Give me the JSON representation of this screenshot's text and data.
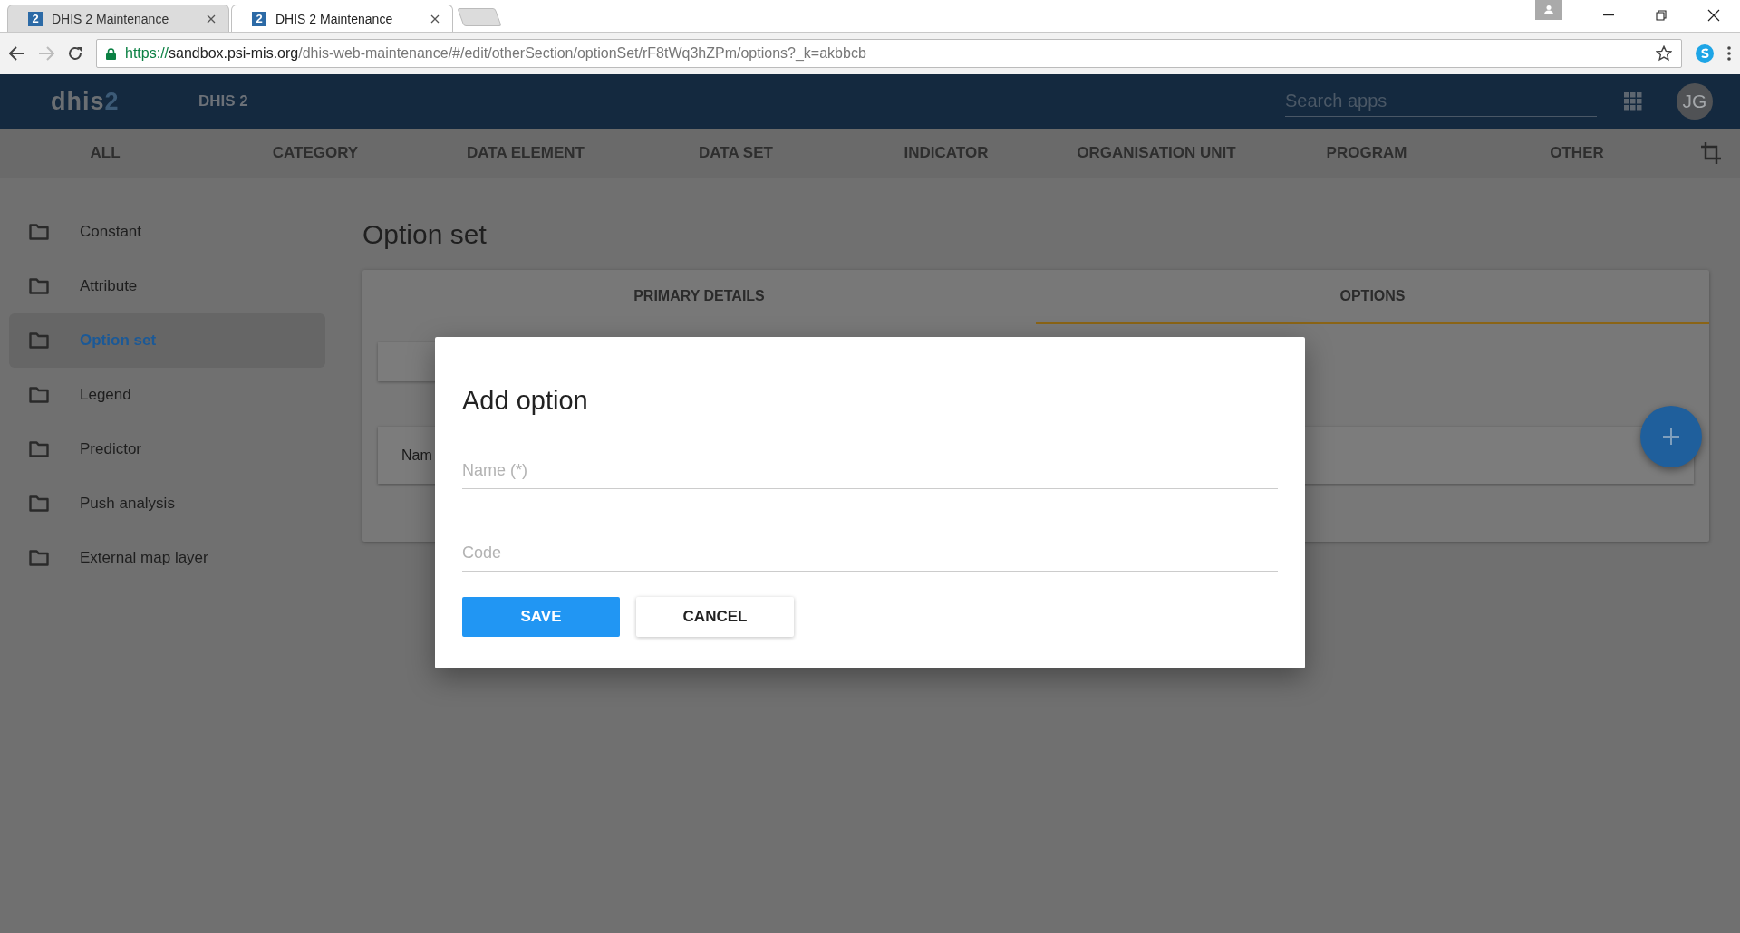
{
  "browser": {
    "tabs": [
      {
        "favicon": "2",
        "title": "DHIS 2 Maintenance",
        "selected": false
      },
      {
        "favicon": "2",
        "title": "DHIS 2 Maintenance",
        "selected": true
      }
    ],
    "url": {
      "scheme": "https://",
      "host": "sandbox.psi-mis.org",
      "path": "/dhis-web-maintenance/#/edit/otherSection/optionSet/rF8tWq3hZPm/options?_k=akbbcb"
    }
  },
  "header": {
    "logo": {
      "text": "dhis",
      "accent": "2"
    },
    "title": "DHIS 2",
    "search": {
      "placeholder": "Search apps"
    },
    "avatar": "JG"
  },
  "nav": [
    {
      "label": "ALL"
    },
    {
      "label": "CATEGORY"
    },
    {
      "label": "DATA ELEMENT"
    },
    {
      "label": "DATA SET"
    },
    {
      "label": "INDICATOR"
    },
    {
      "label": "ORGANISATION UNIT"
    },
    {
      "label": "PROGRAM"
    },
    {
      "label": "OTHER"
    }
  ],
  "sidebar": {
    "items": [
      {
        "label": "Constant",
        "selected": false
      },
      {
        "label": "Attribute",
        "selected": false
      },
      {
        "label": "Option set",
        "selected": true
      },
      {
        "label": "Legend",
        "selected": false
      },
      {
        "label": "Predictor",
        "selected": false
      },
      {
        "label": "Push analysis",
        "selected": false
      },
      {
        "label": "External map layer",
        "selected": false
      }
    ]
  },
  "page": {
    "title": "Option set",
    "tabs": [
      {
        "label": "PRIMARY DETAILS",
        "selected": false
      },
      {
        "label": "OPTIONS",
        "selected": true
      }
    ],
    "list_header": "Nam"
  },
  "dialog": {
    "title": "Add option",
    "fields": [
      {
        "placeholder": "Name (*)"
      },
      {
        "placeholder": "Code"
      }
    ],
    "buttons": [
      {
        "label": "SAVE",
        "kind": "primary"
      },
      {
        "label": "CANCEL",
        "kind": "secondary"
      }
    ]
  }
}
